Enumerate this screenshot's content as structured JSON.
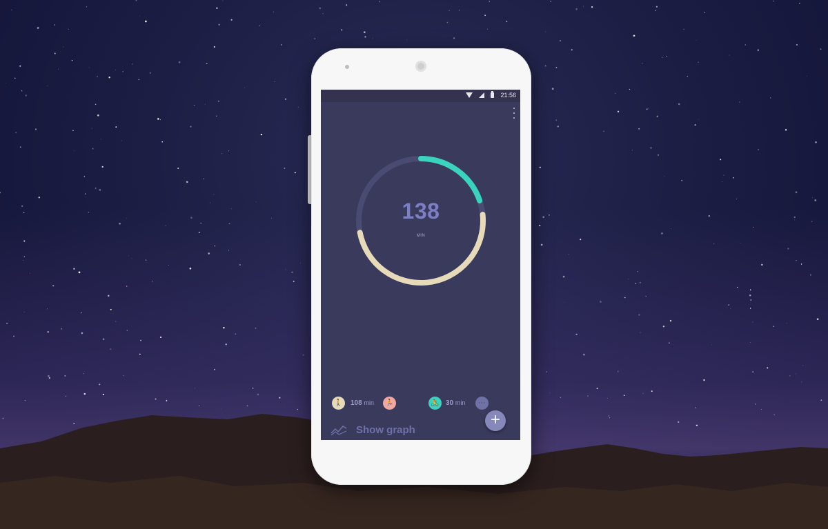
{
  "status_bar": {
    "time": "21:56"
  },
  "ring": {
    "value": "138",
    "unit": "MIN",
    "total_minutes": 138,
    "segments": [
      {
        "name": "walking",
        "minutes": 108,
        "color": "#e7dab8"
      },
      {
        "name": "cycling",
        "minutes": 30,
        "color": "#3ad4be"
      }
    ],
    "track_color": "#4a4b72"
  },
  "activities": [
    {
      "icon": "walking-icon",
      "label": "108",
      "unit": "min",
      "color": "#e7dab8"
    },
    {
      "icon": "running-icon",
      "label": "",
      "unit": "",
      "color": "#f2a8a0"
    },
    {
      "icon": "cycling-icon",
      "label": "30",
      "unit": "min",
      "color": "#3ad4be"
    },
    {
      "icon": "more-icon",
      "label": "",
      "unit": "",
      "color": "#7072a6"
    }
  ],
  "footer": {
    "show_graph_label": "Show graph",
    "add_icon": "plus-icon"
  }
}
